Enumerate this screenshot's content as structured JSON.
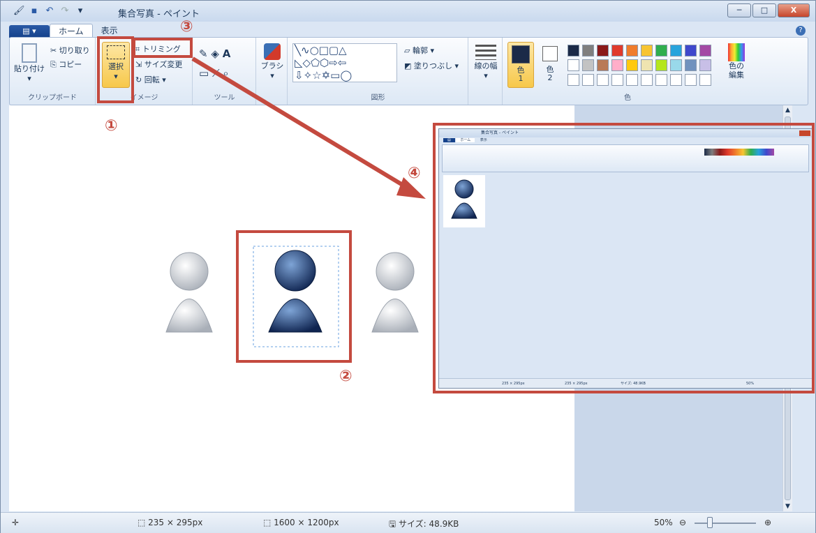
{
  "window": {
    "title": "集合写真 - ペイント",
    "min": "─",
    "max": "□",
    "close": "X"
  },
  "qat": {
    "save_icon": "save-icon",
    "undo_icon": "undo-icon",
    "redo_icon": "redo-icon"
  },
  "tabs": [
    {
      "label": "ホーム"
    },
    {
      "label": "表示"
    }
  ],
  "ribbon": {
    "clipboard": {
      "paste": "貼り付け",
      "cut": "切り取り",
      "copy": "コピー",
      "group": "クリップボード"
    },
    "image": {
      "select": "選択",
      "crop": "トリミング",
      "resize": "サイズ変更",
      "rotate": "回転 ▾",
      "group": "イメージ"
    },
    "tools": {
      "group": "ツール"
    },
    "brush": "ブラシ",
    "shapes": {
      "outline": "輪郭 ▾",
      "fill": "塗りつぶし ▾",
      "group": "図形"
    },
    "size": "線の幅",
    "colors": {
      "color1": "色 1",
      "color2": "色 2",
      "edit": "色の編集",
      "group": "色",
      "palette_top": [
        "#1b2a48",
        "#7f7f7f",
        "#8b1a1a",
        "#e03a2c",
        "#f07c2c",
        "#f7c431",
        "#2fae4e",
        "#27a3dc",
        "#3f48cc",
        "#a349a4"
      ],
      "palette_mid": [
        "#ffffff",
        "#c3c3c3",
        "#b97a57",
        "#ffaec9",
        "#ffc90e",
        "#efe4b0",
        "#b5e61d",
        "#99d9ea",
        "#7092be",
        "#c8bfe7"
      ]
    }
  },
  "status": {
    "selection": "235 × 295px",
    "canvas": "1600 × 1200px",
    "size": "サイズ: 48.9KB",
    "zoom": "50%"
  },
  "annotations": {
    "n1": "①",
    "n2": "②",
    "n3": "③",
    "n4": "④"
  },
  "inset": {
    "title": "集合写真 - ペイント",
    "tab_home": "ホーム",
    "tab_view": "表示",
    "status_sel": "235 × 295px",
    "status_canvas": "235 × 295px",
    "status_size": "サイズ: 48.9KB",
    "zoom": "50%"
  }
}
